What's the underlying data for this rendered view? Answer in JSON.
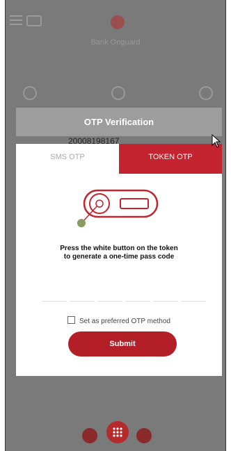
{
  "app": {
    "title": "Bank Onguard"
  },
  "dialog": {
    "title": "OTP Verification",
    "background_number": "20008198167",
    "tabs": [
      {
        "label": "SMS OTP",
        "active": false
      },
      {
        "label": "TOKEN OTP",
        "active": true
      }
    ],
    "instruction_line1": "Press the white button on the token",
    "instruction_line2": "to generate a one-time pass code",
    "pin_digits": [
      "",
      "",
      "",
      "",
      "",
      ""
    ],
    "preferred_label": "Set as preferred OTP method",
    "preferred_checked": false,
    "submit_label": "Submit"
  },
  "colors": {
    "accent": "#c3242f",
    "overlay": "#7a7a7a",
    "submit": "#b41e27"
  }
}
